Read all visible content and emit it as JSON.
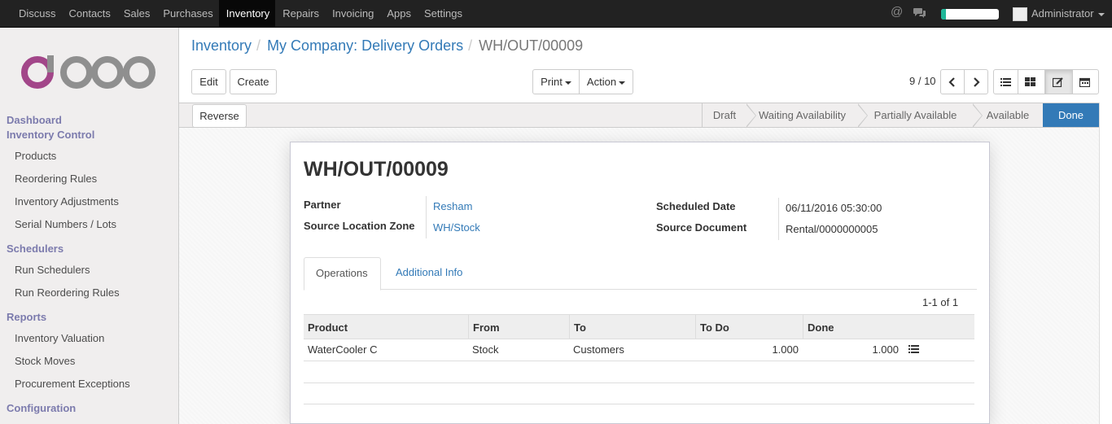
{
  "topbar": {
    "menu": [
      "Discuss",
      "Contacts",
      "Sales",
      "Purchases",
      "Inventory",
      "Repairs",
      "Invoicing",
      "Apps",
      "Settings"
    ],
    "active_menu": "Inventory",
    "progress": 0.08,
    "user": "Administrator"
  },
  "sidebar": {
    "logo": "odoo",
    "sections": [
      {
        "label": "Dashboard",
        "items": []
      },
      {
        "label": "Inventory Control",
        "items": [
          "Products",
          "Reordering Rules",
          "Inventory Adjustments",
          "Serial Numbers / Lots"
        ]
      },
      {
        "label": "Schedulers",
        "items": [
          "Run Schedulers",
          "Run Reordering Rules"
        ]
      },
      {
        "label": "Reports",
        "items": [
          "Inventory Valuation",
          "Stock Moves",
          "Procurement Exceptions"
        ]
      },
      {
        "label": "Configuration",
        "items": []
      }
    ]
  },
  "breadcrumb": {
    "items": [
      "Inventory",
      "My Company: Delivery Orders"
    ],
    "current": "WH/OUT/00009"
  },
  "buttons": {
    "edit": "Edit",
    "create": "Create",
    "print": "Print",
    "action": "Action",
    "reverse": "Reverse"
  },
  "pager": "9 / 10",
  "statusbar": {
    "stages": [
      "Draft",
      "Waiting Availability",
      "Partially Available",
      "Available",
      "Done"
    ],
    "current": "Done",
    "colors": {
      "current": "#337ab7"
    }
  },
  "record": {
    "title": "WH/OUT/00009",
    "fields": {
      "partner_label": "Partner",
      "partner": "Resham",
      "source_location_label": "Source Location Zone",
      "source_location": "WH/Stock",
      "scheduled_date_label": "Scheduled Date",
      "scheduled_date": "06/11/2016 05:30:00",
      "source_document_label": "Source Document",
      "source_document": "Rental/0000000005"
    }
  },
  "tabs": [
    "Operations",
    "Additional Info"
  ],
  "table": {
    "pager": "1-1 of 1",
    "columns": [
      "Product",
      "From",
      "To",
      "To Do",
      "Done"
    ],
    "rows": [
      {
        "product": "WaterCooler C",
        "from": "Stock",
        "to": "Customers",
        "todo": "1.000",
        "done": "1.000"
      }
    ]
  }
}
